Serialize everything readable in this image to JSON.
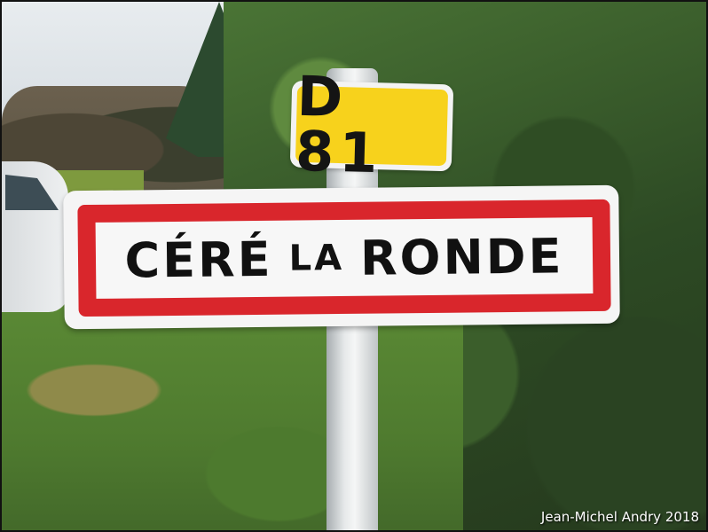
{
  "route_sign": {
    "code": "D 81"
  },
  "town_sign": {
    "part1": "CÉRÉ",
    "part2": "LA",
    "part3": "RONDE"
  },
  "credit": "Jean-Michel Andry 2018",
  "colors": {
    "sign_red": "#d9262c",
    "route_yellow": "#f7d21c",
    "foliage": "#2d4a24"
  }
}
